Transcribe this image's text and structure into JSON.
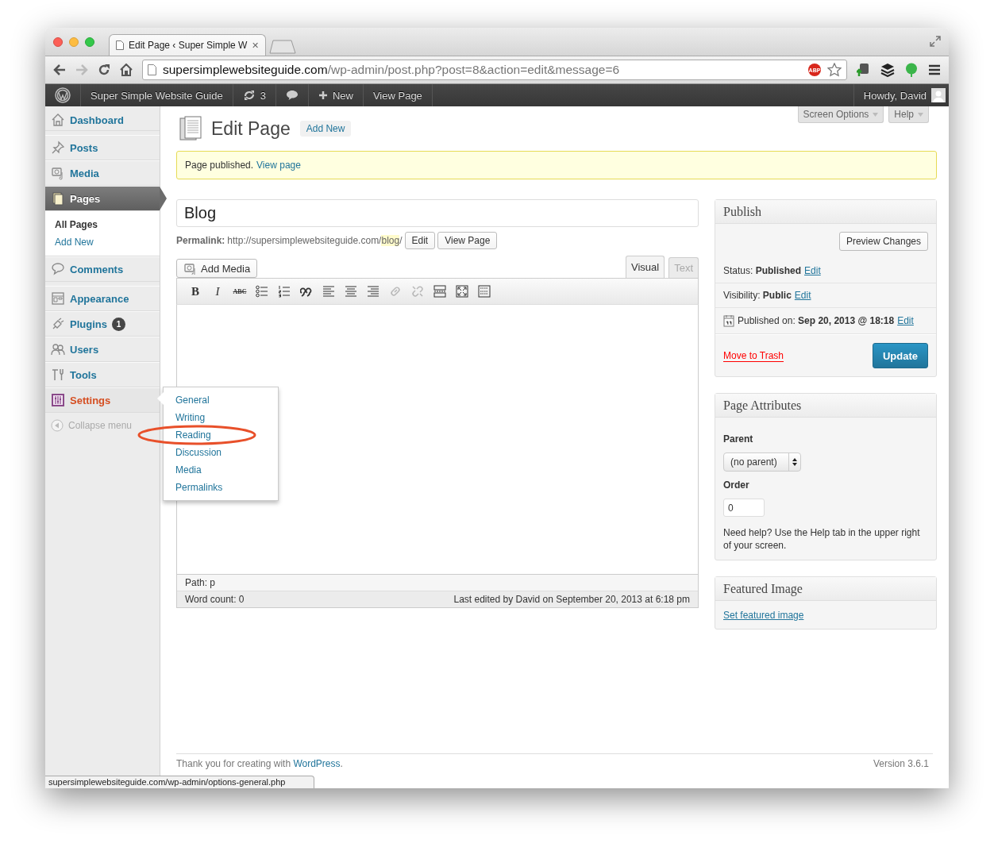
{
  "browser": {
    "tab_title": "Edit Page ‹ Super Simple W",
    "tab_close": "✕",
    "url_host": "supersimplewebsiteguide.com",
    "url_path": "/wp-admin/post.php?post=8&action=edit&message=6",
    "adblock_badge": "ABP",
    "status_bubble": "supersimplewebsiteguide.com/wp-admin/options-general.php"
  },
  "admin_bar": {
    "site_name": "Super Simple Website Guide",
    "updates": "3",
    "new_label": "New",
    "view_label": "View Page",
    "greeting": "Howdy, David"
  },
  "sidebar": {
    "items": [
      {
        "label": "Dashboard",
        "selected": false,
        "hovered": false
      },
      {
        "label": "Posts",
        "selected": false,
        "hovered": false
      },
      {
        "label": "Media",
        "selected": false,
        "hovered": false
      },
      {
        "label": "Pages",
        "selected": true,
        "hovered": false,
        "children": [
          {
            "label": "All Pages",
            "selected": true
          },
          {
            "label": "Add New",
            "selected": false
          }
        ]
      },
      {
        "label": "Comments",
        "selected": false,
        "hovered": false
      },
      {
        "label": "Appearance",
        "selected": false,
        "hovered": false
      },
      {
        "label": "Plugins",
        "selected": false,
        "hovered": false,
        "badge": "1"
      },
      {
        "label": "Users",
        "selected": false,
        "hovered": false
      },
      {
        "label": "Tools",
        "selected": false,
        "hovered": false
      },
      {
        "label": "Settings",
        "selected": false,
        "hovered": true,
        "flyout": [
          {
            "label": "General",
            "circled": false
          },
          {
            "label": "Writing",
            "circled": false
          },
          {
            "label": "Reading",
            "circled": true
          },
          {
            "label": "Discussion",
            "circled": false
          },
          {
            "label": "Media",
            "circled": false
          },
          {
            "label": "Permalinks",
            "circled": false
          }
        ]
      }
    ],
    "collapse_label": "Collapse menu"
  },
  "screen_meta": [
    "Screen Options",
    "Help"
  ],
  "heading": {
    "title": "Edit Page",
    "add_new": "Add New"
  },
  "notice": {
    "text": "Page published.",
    "link": "View page"
  },
  "editor": {
    "title": "Blog",
    "permalink_label": "Permalink:",
    "url_prefix": "http://supersimplewebsiteguide.com/",
    "slug": "blog",
    "url_suffix": "/",
    "permalink_buttons": [
      "Edit",
      "View Page"
    ],
    "add_media": "Add Media",
    "tabs": [
      {
        "label": "Visual",
        "selected": true
      },
      {
        "label": "Text",
        "selected": false
      }
    ],
    "toolbar": [
      {
        "kind": "bold",
        "glyph": "B",
        "disabled": false
      },
      {
        "kind": "italic",
        "glyph": "I",
        "disabled": false
      },
      {
        "kind": "strike",
        "glyph": "ABC",
        "disabled": false
      },
      {
        "kind": "bullets",
        "disabled": false
      },
      {
        "kind": "numbers",
        "disabled": false
      },
      {
        "kind": "quote",
        "disabled": false
      },
      {
        "kind": "align-left",
        "disabled": false
      },
      {
        "kind": "align-center",
        "disabled": false
      },
      {
        "kind": "align-right",
        "disabled": false
      },
      {
        "kind": "link",
        "disabled": true
      },
      {
        "kind": "unlink",
        "disabled": true
      },
      {
        "kind": "more",
        "disabled": false
      },
      {
        "kind": "fullscreen",
        "disabled": false
      },
      {
        "kind": "kitchen-sink",
        "disabled": false
      }
    ],
    "path": "Path: p",
    "word_count": "Word count: 0",
    "last_edited": "Last edited by David on September 20, 2013 at 6:18 pm"
  },
  "publish": {
    "title": "Publish",
    "preview": "Preview Changes",
    "rows": [
      {
        "kind": "plain",
        "label": "Status:",
        "value": "Published",
        "link": "Edit"
      },
      {
        "kind": "plain",
        "label": "Visibility:",
        "value": "Public",
        "link": "Edit"
      },
      {
        "kind": "date",
        "label": "Published on:",
        "value": "Sep 20, 2013 @ 18:18",
        "link": "Edit"
      }
    ],
    "trash": "Move to Trash",
    "update": "Update"
  },
  "page_attributes": {
    "title": "Page Attributes",
    "parent_label": "Parent",
    "parent_value": "(no parent)",
    "order_label": "Order",
    "order_value": "0",
    "help": "Need help? Use the Help tab in the upper right of your screen."
  },
  "featured_image": {
    "title": "Featured Image",
    "link": "Set featured image"
  },
  "footer": {
    "thanks": "Thank you for creating with",
    "link": "WordPress",
    "end": ".",
    "version": "Version 3.6.1"
  }
}
